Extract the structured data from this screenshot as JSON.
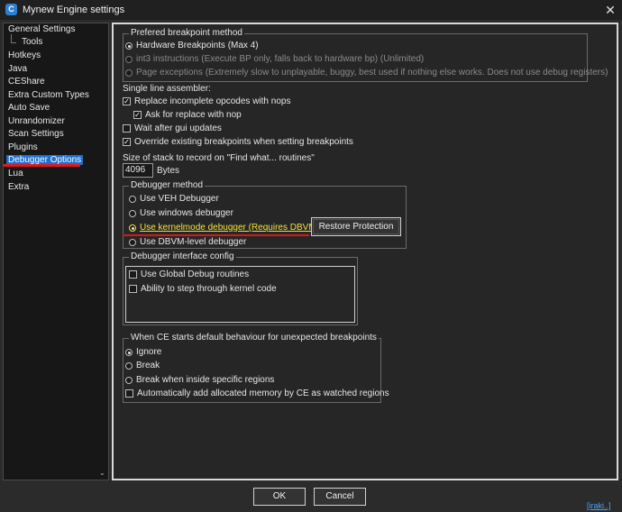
{
  "window": {
    "title": "Mynew Engine settings",
    "icon_letter": "C",
    "close_symbol": "✕"
  },
  "sidebar": {
    "items": [
      {
        "label": "General Settings"
      },
      {
        "label": "Tools"
      },
      {
        "label": "Hotkeys"
      },
      {
        "label": "Java"
      },
      {
        "label": "CEShare"
      },
      {
        "label": "Extra Custom Types"
      },
      {
        "label": "Auto Save"
      },
      {
        "label": "Unrandomizer"
      },
      {
        "label": "Scan Settings"
      },
      {
        "label": "Plugins"
      },
      {
        "label": "Debugger Options"
      },
      {
        "label": "Lua"
      },
      {
        "label": "Extra"
      }
    ],
    "selected": "Debugger Options",
    "scroll_down": "⌄"
  },
  "breakpoint_method": {
    "title": "Prefered breakpoint method",
    "options": [
      {
        "label": "Hardware Breakpoints (Max 4)",
        "selected": true
      },
      {
        "label": "int3 instructions (Execute BP only, falls back to hardware bp) (Unlimited)",
        "selected": false
      },
      {
        "label": "Page exceptions (Extremely slow to unplayable, buggy, best used if nothing else works. Does not use debug registers)",
        "selected": false
      }
    ]
  },
  "assembler": {
    "label": "Single line assembler:",
    "replace_nops": "Replace incomplete opcodes with nops",
    "ask_replace": "Ask for replace with nop",
    "wait_gui": "Wait after gui updates",
    "override_bp": "Override existing breakpoints when setting breakpoints"
  },
  "stack": {
    "label": "Size of stack to record on \"Find what... routines\"",
    "value": "4096",
    "unit": "Bytes"
  },
  "debugger_method": {
    "title": "Debugger method",
    "options": [
      {
        "label": "Use VEH Debugger",
        "selected": false
      },
      {
        "label": "Use windows debugger",
        "selected": false
      },
      {
        "label": "Use kernelmode debugger (Requires DBVM)",
        "selected": true
      },
      {
        "label": "Use DBVM-level debugger",
        "selected": false
      }
    ],
    "restore_button": "Restore Protection"
  },
  "interface_config": {
    "title": "Debugger interface config",
    "global_debug": "Use Global Debug routines",
    "kernel_step": "Ability to step through kernel code"
  },
  "unexpected_bp": {
    "title": "When CE starts default behaviour for unexpected breakpoints",
    "options": [
      {
        "label": "Ignore",
        "selected": true
      },
      {
        "label": "Break",
        "selected": false
      },
      {
        "label": "Break when inside specific regions",
        "selected": false
      }
    ],
    "auto_add": "Automatically add allocated memory by CE as watched regions"
  },
  "footer": {
    "ok": "OK",
    "cancel": "Cancel",
    "status": "[iraki..]"
  },
  "colors": {
    "selection": "#1f6fd1",
    "highlight_text": "#f1e43a",
    "annotation_red": "#d11b1b"
  }
}
